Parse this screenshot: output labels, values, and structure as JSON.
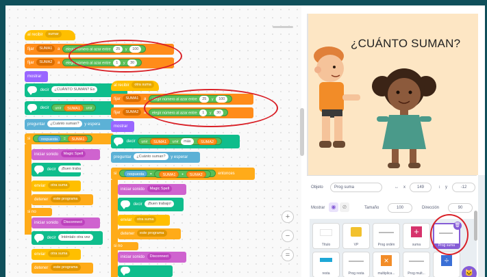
{
  "code": {
    "script1": {
      "hat": "al recibir",
      "hat_msg": "sumar",
      "set1_prefix": "fijar",
      "set1_var": "SUMA1",
      "set1_to": "a",
      "set1_random": "elegir número al azar entre",
      "set1_from": "25",
      "set1_and": "y",
      "set1_to_val": "100",
      "set2_prefix": "fijar",
      "set2_var": "SUMA2",
      "set2_to": "a",
      "set2_random": "elegir número al azar entre",
      "set2_from": "1",
      "set2_and": "y",
      "set2_to_val": "30",
      "show": "mostrar",
      "say1_label": "decir",
      "say1_text": "¿CUÁNTO SUMAN? Es",
      "say2_label": "decir",
      "say2_word": "unir",
      "say2_var": "SUMA1",
      "say2_word2": "unir",
      "ask_label": "preguntar",
      "ask_text": "¿Cuánto suman?",
      "ask_wait": "y espera",
      "if_label": "si",
      "if_answer": "respuesta",
      "if_eq": "=",
      "if_var": "SUMA1",
      "sound1_label": "iniciar sonido",
      "sound1_val": "Magic Spell",
      "say3_label": "decir",
      "say3_text": "¡Buen trabajo",
      "send1_label": "enviar",
      "send1_val": "otra suma",
      "stop1_label": "detener",
      "stop1_val": "este programa",
      "else_label": "si no",
      "sound2_label": "iniciar sonido",
      "sound2_val": "Disconnect",
      "say4_label": "decir",
      "say4_text": "Inténtalo otra vez",
      "send2_label": "enviar",
      "send2_val": "otra suma",
      "stop2_label": "detener",
      "stop2_val": "este programa"
    },
    "script2": {
      "hat": "al recibir",
      "hat_msg": "otra suma",
      "set1_prefix": "fijar",
      "set1_var": "SUMA1",
      "set1_to": "a",
      "set1_random": "elegir número al azar entre",
      "set1_from": "25",
      "set1_and": "y",
      "set1_to_val": "100",
      "set2_prefix": "fijar",
      "set2_var": "SUMA2",
      "set2_to": "a",
      "set2_random": "elegir número al azar entre",
      "set2_from": "1",
      "set2_and": "y",
      "set2_to_val": "30",
      "show": "mostrar",
      "say_label": "decir",
      "say_word": "unir",
      "say_var1": "SUMA1",
      "say_word2": "unir",
      "say_plus": "más",
      "say_var2": "SUMA2",
      "ask_label": "preguntar",
      "ask_text": "¿Cuánto suman?",
      "ask_wait": "y esperar",
      "if_label": "si",
      "if_answer": "respuesta",
      "if_eq": "=",
      "if_var1": "SUMA1",
      "if_plus": "+",
      "if_var2": "SUMA2",
      "if_then": "entonces",
      "sound1_label": "iniciar sonido",
      "sound1_val": "Magic Spell",
      "say2_label": "decir",
      "say2_text": "¡Buen trabajo!",
      "send_label": "enviar",
      "send_val": "otra suma",
      "stop_label": "detener",
      "stop_val": "este programa",
      "else_label": "si no",
      "sound2_label": "iniciar sonido",
      "sound2_val": "Disconnect"
    }
  },
  "zoom": {
    "in": "+",
    "out": "−",
    "reset": "="
  },
  "stage": {
    "title": "¿CUÁNTO SUMAN?"
  },
  "sprite_info": {
    "sprite_label": "Objeto",
    "sprite_name": "Prog suma",
    "x_label": "x",
    "x_value": "149",
    "y_label": "y",
    "y_value": "-12",
    "show_label": "Mostrar",
    "size_label": "Tamaño",
    "size_value": "100",
    "direction_label": "Dirección",
    "direction_value": "90"
  },
  "sprites": [
    {
      "name": "Título"
    },
    {
      "name": "VP"
    },
    {
      "name": "Prog ordén"
    },
    {
      "name": "suma"
    },
    {
      "name": "Prog suma"
    },
    {
      "name": "resta"
    },
    {
      "name": "Prog resta"
    },
    {
      "name": "multiplica..."
    },
    {
      "name": "Prog mult..."
    },
    {
      "name": ""
    }
  ],
  "colors": {
    "events": "#ffbf00",
    "variables": "#ff8c1a",
    "control": "#ffab19",
    "looks": "#9966ff",
    "sound": "#cf63cf",
    "sensing": "#5cb1d6",
    "operators": "#59c059",
    "extension": "#0fbd8c",
    "highlight": "#d92027",
    "selection": "#855cd6"
  }
}
